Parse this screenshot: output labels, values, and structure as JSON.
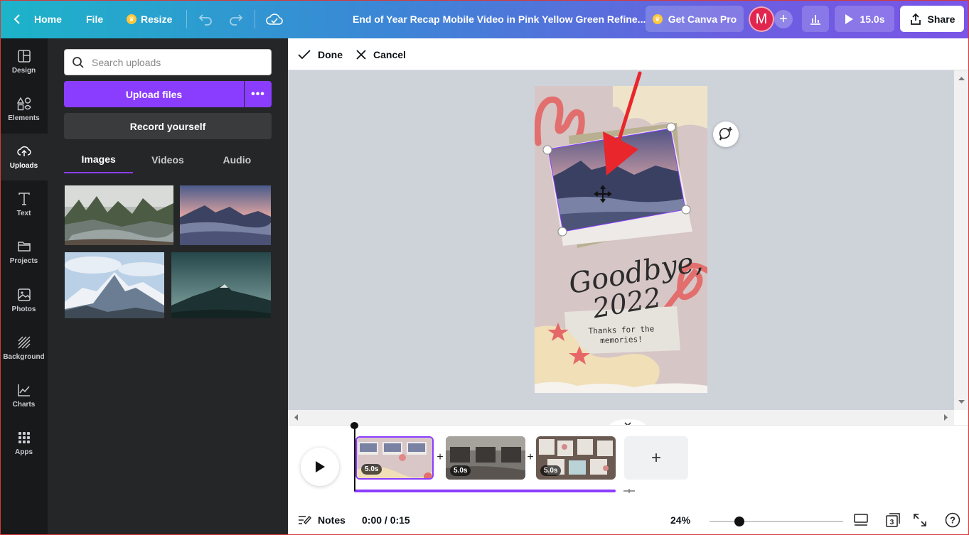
{
  "topbar": {
    "home_label": "Home",
    "file_label": "File",
    "resize_label": "Resize",
    "doc_title": "End of Year Recap Mobile Video in Pink Yellow Green Refine...",
    "pro_label": "Get Canva Pro",
    "avatar_initial": "M",
    "duration_label": "15.0s",
    "share_label": "Share"
  },
  "rail": {
    "items": [
      {
        "label": "Design",
        "icon": "design-icon"
      },
      {
        "label": "Elements",
        "icon": "elements-icon"
      },
      {
        "label": "Uploads",
        "icon": "uploads-icon"
      },
      {
        "label": "Text",
        "icon": "text-icon"
      },
      {
        "label": "Projects",
        "icon": "folder-icon"
      },
      {
        "label": "Photos",
        "icon": "photos-icon"
      },
      {
        "label": "Background",
        "icon": "background-icon"
      },
      {
        "label": "Charts",
        "icon": "charts-icon"
      },
      {
        "label": "Apps",
        "icon": "apps-icon"
      }
    ],
    "active": "Uploads"
  },
  "panel": {
    "search_placeholder": "Search uploads",
    "upload_label": "Upload files",
    "record_label": "Record yourself",
    "tabs": [
      "Images",
      "Videos",
      "Audio"
    ],
    "active_tab": "Images"
  },
  "editbar": {
    "done_label": "Done",
    "cancel_label": "Cancel"
  },
  "canvas": {
    "headline": "Goodbye,",
    "year": "2022",
    "note_line1": "Thanks for the",
    "note_line2": "memories!"
  },
  "timeline": {
    "clips": [
      {
        "duration": "5.0s"
      },
      {
        "duration": "5.0s"
      },
      {
        "duration": "5.0s"
      }
    ],
    "add_label": "+"
  },
  "footer": {
    "notes_label": "Notes",
    "time_label": "0:00 / 0:15",
    "zoom_label": "24%",
    "zoom_fraction": 0.2,
    "page_count": "3",
    "help_label": "?"
  },
  "colors": {
    "accent": "#8b3dff",
    "avatar": "#e0254f",
    "rail_bg": "#18191b",
    "panel_bg": "#252627"
  }
}
